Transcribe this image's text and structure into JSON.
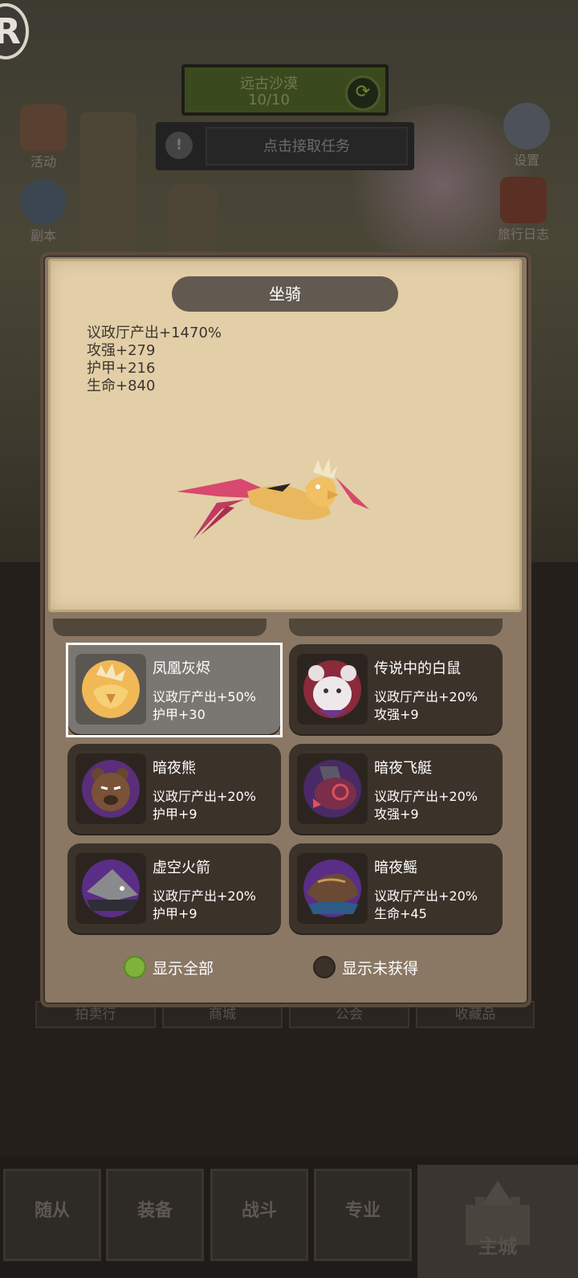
{
  "top_hud": {
    "badge_letter": "R",
    "region_name": "远古沙漠",
    "region_progress": "10/10",
    "task_prompt": "点击接取任务",
    "alert_symbol": "!"
  },
  "side_menu": {
    "activity": "活动",
    "dungeon": "副本",
    "settings": "设置",
    "travel_log": "旅行日志"
  },
  "background_tabs": [
    "拍卖行",
    "商城",
    "公会",
    "收藏品"
  ],
  "bottom_nav": {
    "followers": "随从",
    "equipment": "装备",
    "battle": "战斗",
    "profession": "专业",
    "main_city": "主城"
  },
  "mount_panel": {
    "title": "坐骑",
    "total_stats": [
      "议政厅产出+1470%",
      "攻强+279",
      "护甲+216",
      "生命+840"
    ],
    "mounts": [
      {
        "name": "凤凰灰烬",
        "bonus1": "议政厅产出+50%",
        "bonus2": "护甲+30",
        "selected": true,
        "icon": "phoenix-icon"
      },
      {
        "name": "传说中的白鼠",
        "bonus1": "议政厅产出+20%",
        "bonus2": "攻强+9",
        "selected": false,
        "icon": "white-rat-icon"
      },
      {
        "name": "暗夜熊",
        "bonus1": "议政厅产出+20%",
        "bonus2": "护甲+9",
        "selected": false,
        "icon": "night-bear-icon"
      },
      {
        "name": "暗夜飞艇",
        "bonus1": "议政厅产出+20%",
        "bonus2": "攻强+9",
        "selected": false,
        "icon": "night-airship-icon"
      },
      {
        "name": "虚空火箭",
        "bonus1": "议政厅产出+20%",
        "bonus2": "护甲+9",
        "selected": false,
        "icon": "void-rocket-icon"
      },
      {
        "name": "暗夜鳐",
        "bonus1": "议政厅产出+20%",
        "bonus2": "生命+45",
        "selected": false,
        "icon": "night-ray-icon"
      }
    ],
    "filters": {
      "show_all": "显示全部",
      "show_unowned": "显示未获得",
      "active": "show_all"
    }
  },
  "colors": {
    "panel_parchment": "#e2cfa8",
    "card_bg": "#3b322a",
    "card_selected": "#7a7672",
    "filter_active": "#7db33a",
    "filter_inactive": "#3a3128"
  }
}
